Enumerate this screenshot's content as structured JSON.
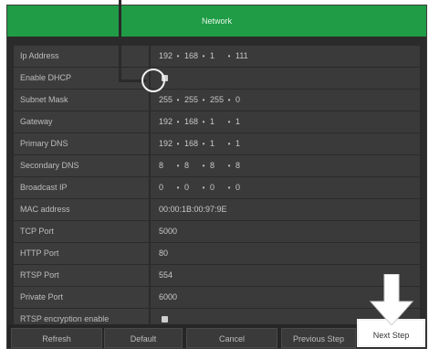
{
  "window": {
    "title": "Network"
  },
  "fields": {
    "ip_address": {
      "label": "Ip Address",
      "octets": [
        "192",
        "168",
        "1",
        "111"
      ]
    },
    "enable_dhcp": {
      "label": "Enable DHCP"
    },
    "subnet_mask": {
      "label": "Subnet Mask",
      "octets": [
        "255",
        "255",
        "255",
        "0"
      ]
    },
    "gateway": {
      "label": "Gateway",
      "octets": [
        "192",
        "168",
        "1",
        "1"
      ]
    },
    "primary_dns": {
      "label": "Primary DNS",
      "octets": [
        "192",
        "168",
        "1",
        "1"
      ]
    },
    "secondary_dns": {
      "label": "Secondary DNS",
      "octets": [
        "8",
        "8",
        "8",
        "8"
      ]
    },
    "broadcast_ip": {
      "label": "Broadcast IP",
      "octets": [
        "0",
        "0",
        "0",
        "0"
      ]
    },
    "mac_address": {
      "label": "MAC address",
      "value": "00:00:1B:00:97:9E"
    },
    "tcp_port": {
      "label": "TCP Port",
      "value": "5000"
    },
    "http_port": {
      "label": "HTTP Port",
      "value": "80"
    },
    "rtsp_port": {
      "label": "RTSP Port",
      "value": "554"
    },
    "private_port": {
      "label": "Private Port",
      "value": "6000"
    },
    "rtsp_encryption": {
      "label": "RTSP encryption enable"
    }
  },
  "buttons": {
    "refresh": "Refresh",
    "default": "Default",
    "cancel": "Cancel",
    "previous_step": "Previous Step",
    "next_step": "Next Step"
  },
  "colors": {
    "titlebar": "#1f9c45",
    "background": "#2b2b2b",
    "label_bg": "#3c3c3c",
    "highlight": "#ffffff"
  }
}
